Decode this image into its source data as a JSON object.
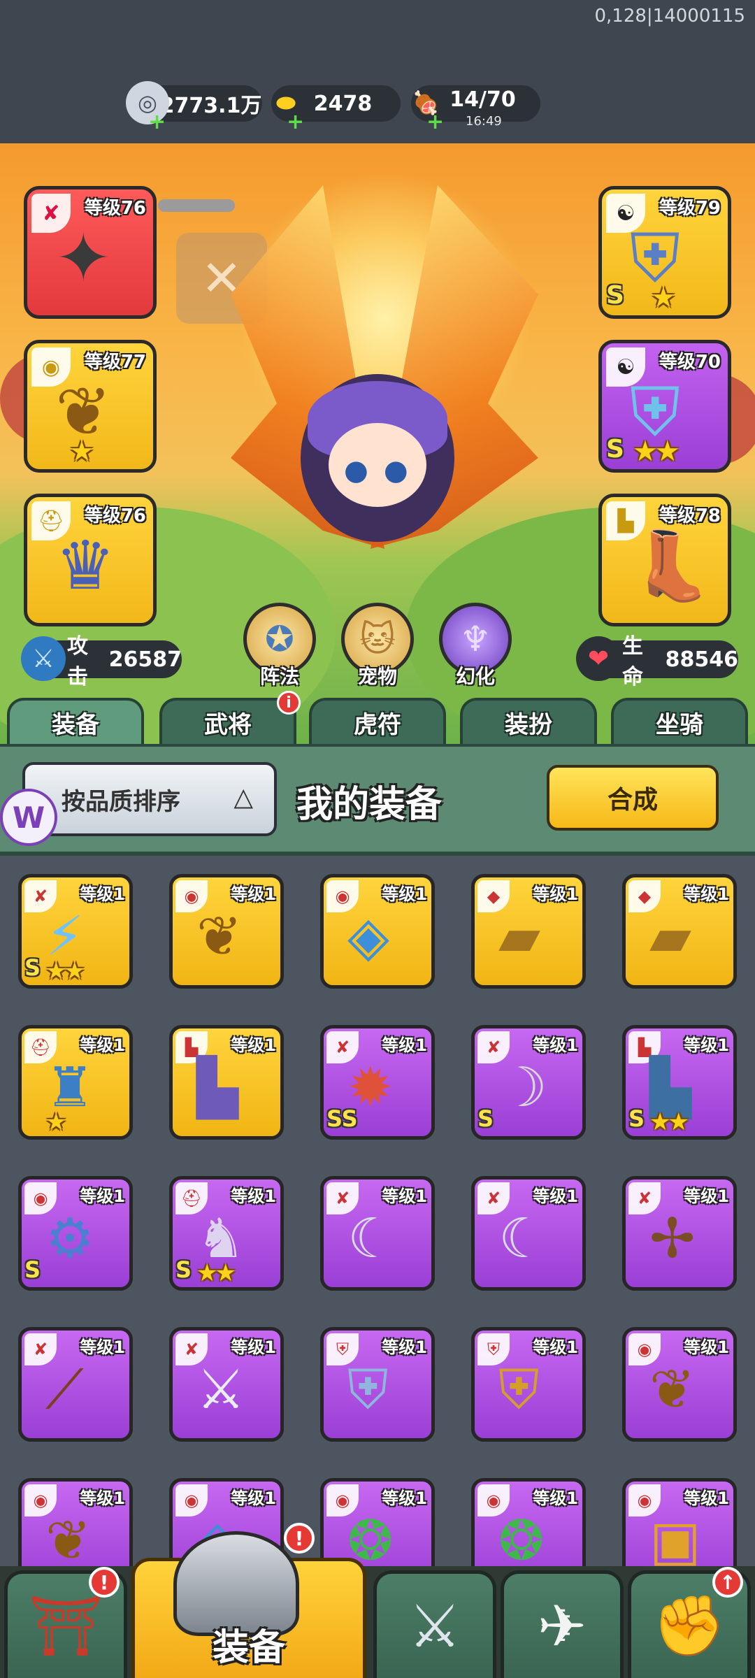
{
  "debug": {
    "coords": "0,128|14000115"
  },
  "resources": {
    "silver": {
      "icon": "silver-coin-icon",
      "value": "2773.1万"
    },
    "gold": {
      "icon": "gold-ingot-icon",
      "value": "2478"
    },
    "stamina": {
      "icon": "meat-leg-icon",
      "value": "14/70",
      "timer": "16:49"
    }
  },
  "equipped": [
    {
      "slot": "weapon",
      "level": "等级76",
      "rarity": "red",
      "art": "shuriken-icon"
    },
    {
      "slot": "amulet",
      "level": "等级77",
      "rarity": "yellow",
      "stars": 1,
      "art": "pendant-icon"
    },
    {
      "slot": "helmet",
      "level": "等级76",
      "rarity": "yellow",
      "art": "helmet-icon"
    },
    {
      "slot": "armor",
      "level": "等级79",
      "rarity": "yellow",
      "s": "S",
      "stars": 1,
      "art": "armor-icon"
    },
    {
      "slot": "armor2",
      "level": "等级70",
      "rarity": "purple",
      "s": "S",
      "stars": 2,
      "art": "armor-icon"
    },
    {
      "slot": "boots",
      "level": "等级78",
      "rarity": "yellow",
      "art": "boots-icon"
    }
  ],
  "stats": {
    "attack": {
      "label": "攻击",
      "value": "26587"
    },
    "hp": {
      "label": "生命",
      "value": "88546"
    }
  },
  "round_buttons": {
    "formation": "阵法",
    "pet": "宠物",
    "transform": "幻化"
  },
  "tabs": [
    {
      "label": "装备",
      "active": true
    },
    {
      "label": "武将",
      "badge": "i"
    },
    {
      "label": "虎符"
    },
    {
      "label": "装扮"
    },
    {
      "label": "坐骑"
    }
  ],
  "filter": {
    "sort_label": "按品质排序",
    "title": "我的装备",
    "compose_label": "合成"
  },
  "inventory": [
    {
      "level": "等级1",
      "rarity": "yellow",
      "type": "weapon",
      "s": "S",
      "stars": 2,
      "art": "crystal-sword-icon"
    },
    {
      "level": "等级1",
      "rarity": "yellow",
      "type": "amulet",
      "art": "pendant-icon"
    },
    {
      "level": "等级1",
      "rarity": "yellow",
      "type": "amulet",
      "art": "gem-pendant-icon"
    },
    {
      "level": "等级1",
      "rarity": "yellow",
      "type": "bracer",
      "art": "bracer-icon"
    },
    {
      "level": "等级1",
      "rarity": "yellow",
      "type": "bracer",
      "art": "bracer-icon"
    },
    {
      "level": "等级1",
      "rarity": "yellow",
      "type": "helmet",
      "stars": 1,
      "art": "blue-helmet-icon"
    },
    {
      "level": "等级1",
      "rarity": "yellow",
      "type": "boots",
      "art": "boots-icon"
    },
    {
      "level": "等级1",
      "rarity": "purple",
      "type": "weapon",
      "s": "SS",
      "art": "dragon-head-icon"
    },
    {
      "level": "等级1",
      "rarity": "purple",
      "type": "weapon",
      "s": "S",
      "art": "curved-blade-icon"
    },
    {
      "level": "等级1",
      "rarity": "purple",
      "type": "boots",
      "s": "S",
      "stars": 2,
      "art": "armored-boots-icon"
    },
    {
      "level": "等级1",
      "rarity": "purple",
      "type": "amulet",
      "s": "S",
      "art": "chain-pendant-icon"
    },
    {
      "level": "等级1",
      "rarity": "purple",
      "type": "helmet",
      "s": "S",
      "stars": 2,
      "art": "knight-helmet-icon"
    },
    {
      "level": "等级1",
      "rarity": "purple",
      "type": "weapon",
      "art": "scimitar-icon"
    },
    {
      "level": "等级1",
      "rarity": "purple",
      "type": "weapon",
      "art": "scimitar-icon"
    },
    {
      "level": "等级1",
      "rarity": "purple",
      "type": "weapon",
      "art": "crossbow-icon"
    },
    {
      "level": "等级1",
      "rarity": "purple",
      "type": "weapon",
      "art": "musket-icon"
    },
    {
      "level": "等级1",
      "rarity": "purple",
      "type": "weapon",
      "art": "glaive-icon"
    },
    {
      "level": "等级1",
      "rarity": "purple",
      "type": "armor",
      "art": "plate-armor-icon"
    },
    {
      "level": "等级1",
      "rarity": "purple",
      "type": "armor",
      "art": "gold-armor-icon"
    },
    {
      "level": "等级1",
      "rarity": "purple",
      "type": "amulet",
      "art": "pendant-icon"
    },
    {
      "level": "等级1",
      "rarity": "purple",
      "type": "amulet",
      "art": "pendant-icon"
    },
    {
      "level": "等级1",
      "rarity": "purple",
      "type": "amulet",
      "art": "gem-pendant-icon"
    },
    {
      "level": "等级1",
      "rarity": "purple",
      "type": "amulet",
      "art": "green-gem-pendant-icon"
    },
    {
      "level": "等级1",
      "rarity": "purple",
      "type": "amulet",
      "art": "green-gem-pendant-icon"
    },
    {
      "level": "等级1",
      "rarity": "purple",
      "type": "amulet",
      "art": "gold-plaque-icon"
    }
  ],
  "bottom_nav": [
    {
      "icon": "shop-gate-icon",
      "badge": "!"
    },
    {
      "icon": "helmet-icon",
      "label": "装备",
      "active": true,
      "badge": "!"
    },
    {
      "icon": "crossed-swords-icon"
    },
    {
      "icon": "winged-boot-icon"
    },
    {
      "icon": "power-fist-icon",
      "badge": "↑"
    }
  ],
  "colors": {
    "yellow_rarity": "#f2b81a",
    "purple_rarity": "#9a3fd6",
    "red_rarity": "#e2393d",
    "tab_green": "#3e6b58",
    "accent_gold": "#ffd33b"
  }
}
